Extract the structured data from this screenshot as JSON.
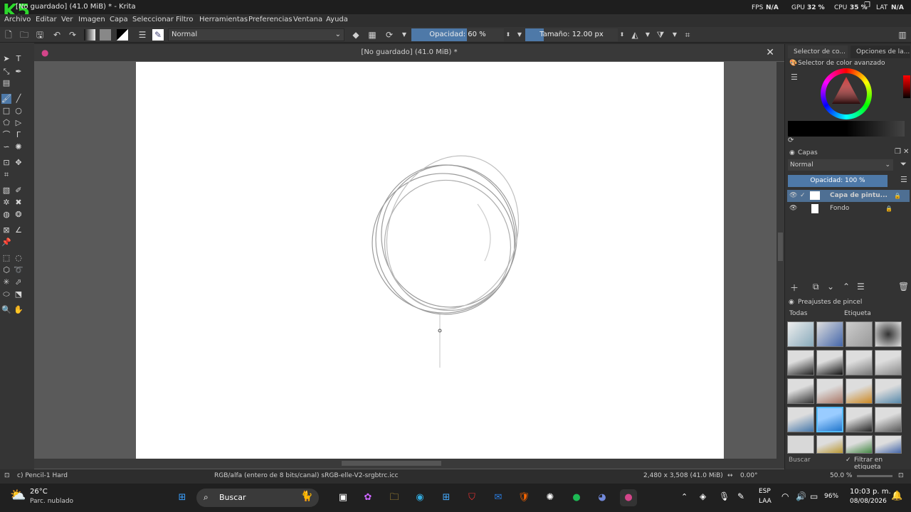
{
  "window": {
    "title": "[No guardado]  (41.0 MiB) * - Krita",
    "fps_label": "FPS",
    "fps_value": "N/A",
    "gpu_label": "GPU",
    "gpu_value": "32 %",
    "cpu_label": "CPU",
    "cpu_value": "35 %",
    "lat_label": "LAT",
    "lat_value": "N/A",
    "logo": "K5"
  },
  "menu": [
    "Archivo",
    "Editar",
    "Ver",
    "Imagen",
    "Capa",
    "Seleccionar",
    "Filtro",
    "Herramientas",
    "Preferencias",
    "Ventana",
    "Ayuda"
  ],
  "toolbar": {
    "blend_mode": "Normal",
    "opacity_label": "Opacidad: 60 %",
    "opacity": 0.6,
    "size_label": "Tamaño: 12.00 px",
    "size_fraction": 0.2
  },
  "document": {
    "tab_title": "[No guardado]  (41.0 MiB) *"
  },
  "dock": {
    "tab1": "Selector de co...",
    "tab2": "Opciones de la...",
    "color_title": "Selector de color avanzado",
    "layers_title": "Capas",
    "layers_blend": "Normal",
    "layers_opacity": "Opacidad: 100 %",
    "layers": [
      {
        "name": "Capa de pintu...",
        "active": true
      },
      {
        "name": "Fondo",
        "active": false
      }
    ],
    "presets_title": "Preajustes de pincel",
    "presets_filter": "Todas",
    "presets_tag": "Etiqueta",
    "search_placeholder": "Buscar",
    "filter_tag_label": "Filtrar en etiqueta"
  },
  "status": {
    "brush": "c) Pencil-1 Hard",
    "color_space": "RGB/alfa (entero de 8 bits/canal)  sRGB-elle-V2-srgbtrc.icc",
    "dims": "2,480 x 3,508 (41.0 MiB)",
    "rotation": "0.00°",
    "zoom": "50.0 %"
  },
  "taskbar": {
    "weather_temp": "26°C",
    "weather_desc": "Parc. nublado",
    "search": "Buscar",
    "lang1": "ESP",
    "lang2": "LAA",
    "battery": "96%",
    "time": "10:03 p. m.",
    "date": "08/08/2026"
  }
}
